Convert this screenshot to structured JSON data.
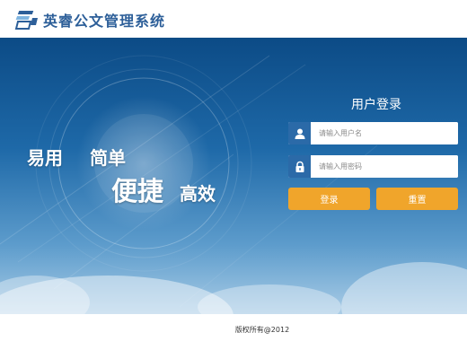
{
  "header": {
    "title": "英睿公文管理系统",
    "logo_icon": "document-stack-icon"
  },
  "banner": {
    "slogan": {
      "part1": "易用",
      "part2": "简单",
      "part3": "便捷",
      "part4": "高效"
    }
  },
  "login": {
    "title": "用户登录",
    "username_placeholder": "请输入用户名",
    "password_placeholder": "请输入用密码",
    "username_icon": "user-icon",
    "password_icon": "lock-icon",
    "login_label": "登录",
    "reset_label": "重置"
  },
  "footer": {
    "copyright": "版权所有@2012"
  },
  "colors": {
    "brand_blue": "#2d5f99",
    "banner_dark": "#0c4b86",
    "icon_blue": "#2b6aa8",
    "button_orange": "#f0a52b"
  }
}
